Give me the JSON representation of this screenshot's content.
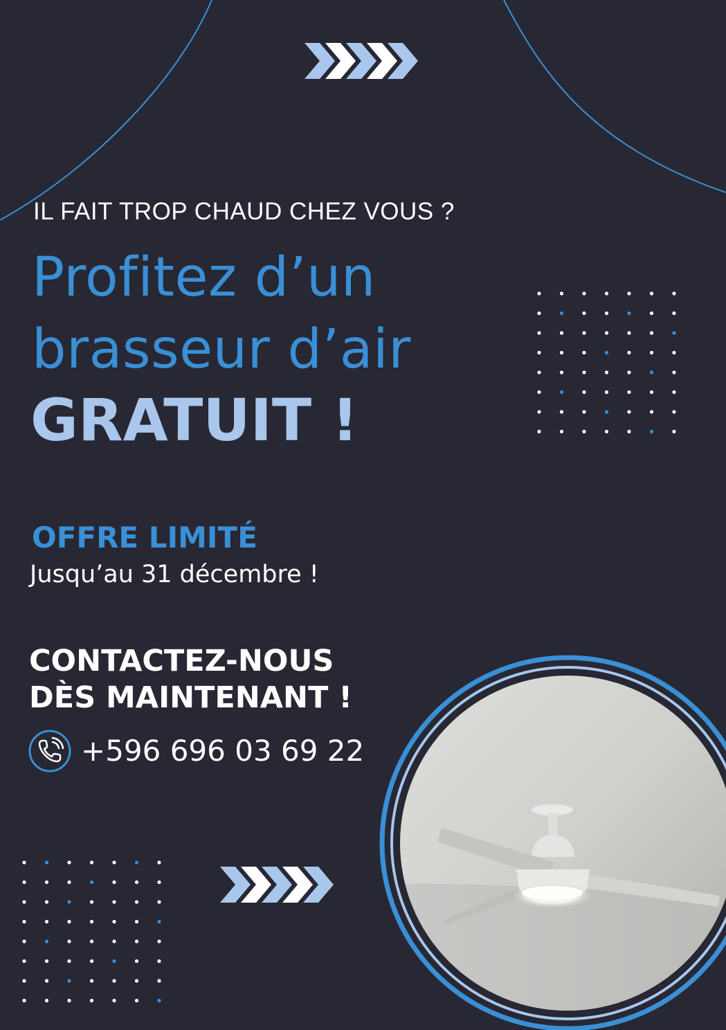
{
  "poster": {
    "eyebrow": "IL FAIT TROP CHAUD CHEZ VOUS ?",
    "headline_line1": "Profitez d’un",
    "headline_line2": "brasseur d’air",
    "headline_emphasis": "GRATUIT !",
    "offer_label": "OFFRE LIMITÉ",
    "offer_until": "Jusqu’au 31 décembre !",
    "cta_line1": "CONTACTEZ-NOUS",
    "cta_line2": "DÈS MAINTENANT !",
    "phone_number": "+596 696 03 69 22"
  },
  "icons": {
    "phone": "phone-icon",
    "chevrons": "chevron-arrows-icon"
  },
  "colors": {
    "background": "#272833",
    "accent_blue": "#3a8fd6",
    "light_blue": "#a9c6ec",
    "text_white": "#ffffff"
  }
}
